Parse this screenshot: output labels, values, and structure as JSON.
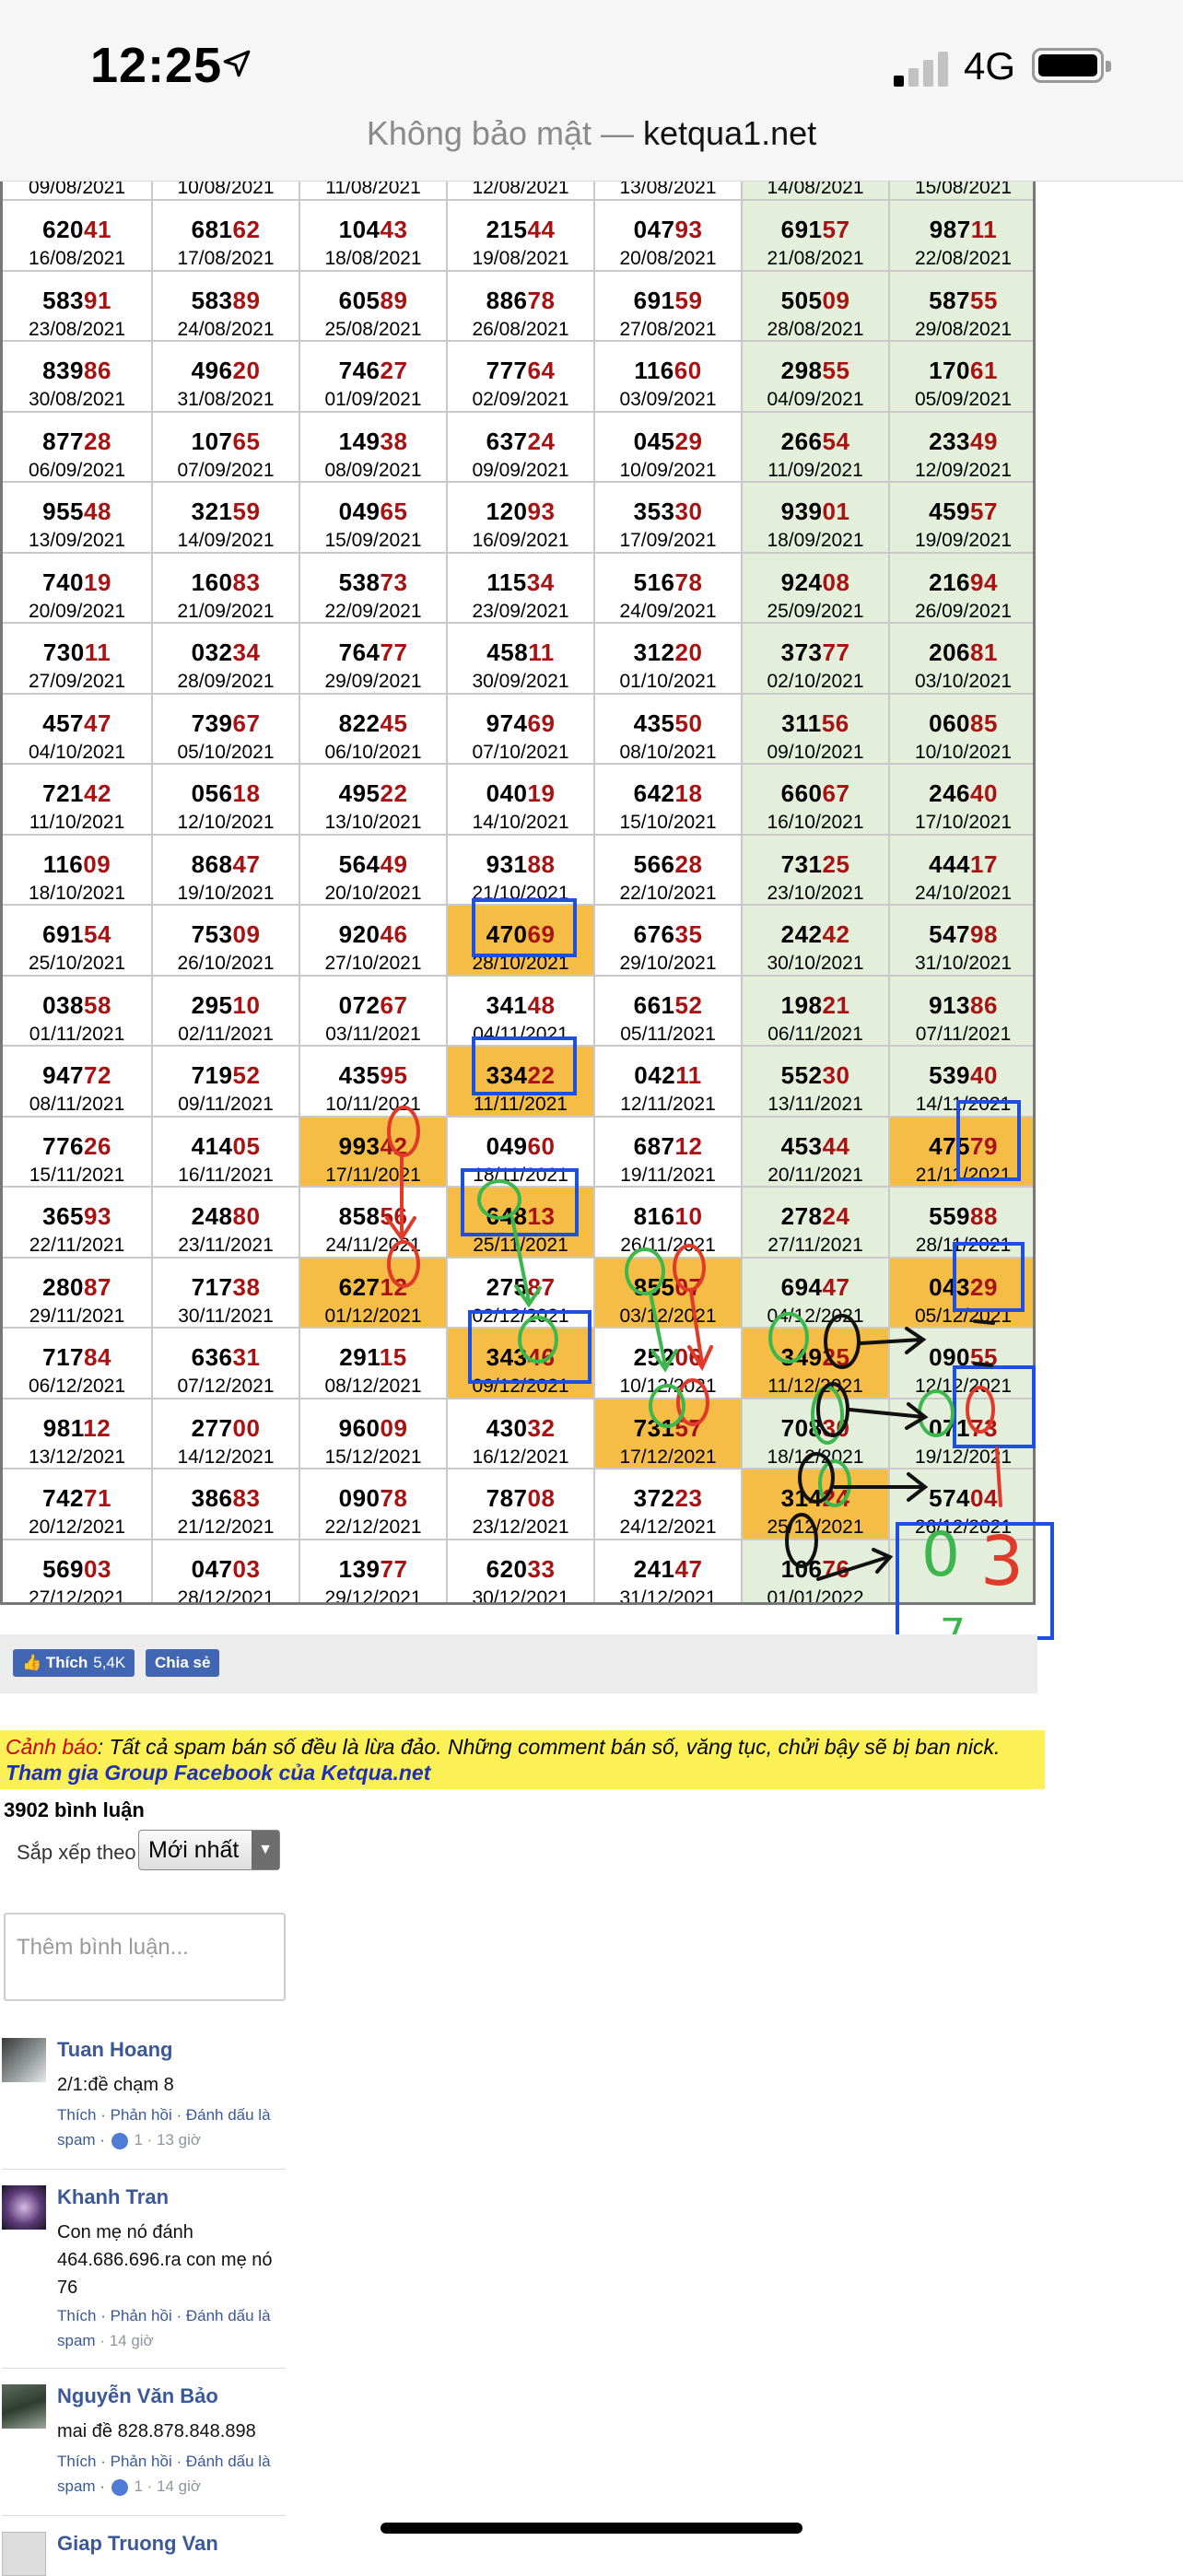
{
  "status": {
    "time": "12:25",
    "network": "4G"
  },
  "urlbar": {
    "insecure": "Không bảo mật — ",
    "domain": "ketqua1.net"
  },
  "table": {
    "rows": [
      [
        [
          "6",
          "2041",
          "16/08/2021"
        ],
        [
          "6",
          "8162",
          "17/08/2021"
        ],
        [
          "1",
          "0443",
          "18/08/2021"
        ],
        [
          "2",
          "1544",
          "19/08/2021"
        ],
        [
          "0",
          "4793",
          "20/08/2021"
        ],
        [
          "6",
          "9157",
          "21/08/2021"
        ],
        [
          "9",
          "8711",
          "22/08/2021"
        ]
      ],
      [
        [
          "5",
          "8391",
          "23/08/2021"
        ],
        [
          "5",
          "8389",
          "24/08/2021"
        ],
        [
          "6",
          "0589",
          "25/08/2021"
        ],
        [
          "8",
          "8678",
          "26/08/2021"
        ],
        [
          "6",
          "9159",
          "27/08/2021"
        ],
        [
          "5",
          "0509",
          "28/08/2021"
        ],
        [
          "5",
          "8755",
          "29/08/2021"
        ]
      ],
      [
        [
          "8",
          "3986",
          "30/08/2021"
        ],
        [
          "4",
          "9620",
          "31/08/2021"
        ],
        [
          "7",
          "4627",
          "01/09/2021"
        ],
        [
          "7",
          "7764",
          "02/09/2021"
        ],
        [
          "1",
          "1660",
          "03/09/2021"
        ],
        [
          "2",
          "9855",
          "04/09/2021"
        ],
        [
          "1",
          "7061",
          "05/09/2021"
        ]
      ],
      [
        [
          "8",
          "7728",
          "06/09/2021"
        ],
        [
          "1",
          "0765",
          "07/09/2021"
        ],
        [
          "1",
          "4938",
          "08/09/2021"
        ],
        [
          "6",
          "3724",
          "09/09/2021"
        ],
        [
          "0",
          "4529",
          "10/09/2021"
        ],
        [
          "2",
          "6654",
          "11/09/2021"
        ],
        [
          "2",
          "3349",
          "12/09/2021"
        ]
      ],
      [
        [
          "9",
          "5548",
          "13/09/2021"
        ],
        [
          "3",
          "2159",
          "14/09/2021"
        ],
        [
          "0",
          "4965",
          "15/09/2021"
        ],
        [
          "1",
          "2093",
          "16/09/2021"
        ],
        [
          "3",
          "5330",
          "17/09/2021"
        ],
        [
          "9",
          "3901",
          "18/09/2021"
        ],
        [
          "4",
          "5957",
          "19/09/2021"
        ]
      ],
      [
        [
          "7",
          "4019",
          "20/09/2021"
        ],
        [
          "1",
          "6083",
          "21/09/2021"
        ],
        [
          "5",
          "3873",
          "22/09/2021"
        ],
        [
          "1",
          "1534",
          "23/09/2021"
        ],
        [
          "5",
          "1678",
          "24/09/2021"
        ],
        [
          "9",
          "2408",
          "25/09/2021"
        ],
        [
          "2",
          "1694",
          "26/09/2021"
        ]
      ],
      [
        [
          "7",
          "3011",
          "27/09/2021"
        ],
        [
          "0",
          "3234",
          "28/09/2021"
        ],
        [
          "7",
          "6477",
          "29/09/2021"
        ],
        [
          "4",
          "5811",
          "30/09/2021"
        ],
        [
          "3",
          "1220",
          "01/10/2021"
        ],
        [
          "3",
          "7377",
          "02/10/2021"
        ],
        [
          "2",
          "0681",
          "03/10/2021"
        ]
      ],
      [
        [
          "4",
          "5747",
          "04/10/2021"
        ],
        [
          "7",
          "3967",
          "05/10/2021"
        ],
        [
          "8",
          "2245",
          "06/10/2021"
        ],
        [
          "9",
          "7469",
          "07/10/2021"
        ],
        [
          "4",
          "3550",
          "08/10/2021"
        ],
        [
          "3",
          "1156",
          "09/10/2021"
        ],
        [
          "0",
          "6085",
          "10/10/2021"
        ]
      ],
      [
        [
          "7",
          "2142",
          "11/10/2021"
        ],
        [
          "0",
          "5618",
          "12/10/2021"
        ],
        [
          "4",
          "9522",
          "13/10/2021"
        ],
        [
          "0",
          "4019",
          "14/10/2021"
        ],
        [
          "6",
          "4218",
          "15/10/2021"
        ],
        [
          "6",
          "6067",
          "16/10/2021"
        ],
        [
          "2",
          "4640",
          "17/10/2021"
        ]
      ],
      [
        [
          "1",
          "1609",
          "18/10/2021"
        ],
        [
          "8",
          "6847",
          "19/10/2021"
        ],
        [
          "5",
          "6449",
          "20/10/2021"
        ],
        [
          "9",
          "3188",
          "21/10/2021"
        ],
        [
          "5",
          "6628",
          "22/10/2021"
        ],
        [
          "7",
          "3125",
          "23/10/2021"
        ],
        [
          "4",
          "4417",
          "24/10/2021"
        ]
      ],
      [
        [
          "6",
          "9154",
          "25/10/2021"
        ],
        [
          "7",
          "5309",
          "26/10/2021"
        ],
        [
          "9",
          "2046",
          "27/10/2021"
        ],
        [
          "4",
          "7069",
          "28/10/2021"
        ],
        [
          "6",
          "7635",
          "29/10/2021"
        ],
        [
          "2",
          "4242",
          "30/10/2021"
        ],
        [
          "5",
          "4798",
          "31/10/2021"
        ]
      ],
      [
        [
          "0",
          "3858",
          "01/11/2021"
        ],
        [
          "2",
          "9510",
          "02/11/2021"
        ],
        [
          "0",
          "7267",
          "03/11/2021"
        ],
        [
          "3",
          "4148",
          "04/11/2021"
        ],
        [
          "6",
          "6152",
          "05/11/2021"
        ],
        [
          "1",
          "9821",
          "06/11/2021"
        ],
        [
          "9",
          "1386",
          "07/11/2021"
        ]
      ],
      [
        [
          "9",
          "4772",
          "08/11/2021"
        ],
        [
          "7",
          "1952",
          "09/11/2021"
        ],
        [
          "4",
          "3595",
          "10/11/2021"
        ],
        [
          "3",
          "3422",
          "11/11/2021"
        ],
        [
          "0",
          "4211",
          "12/11/2021"
        ],
        [
          "5",
          "5230",
          "13/11/2021"
        ],
        [
          "5",
          "3940",
          "14/11/2021"
        ]
      ],
      [
        [
          "7",
          "7626",
          "15/11/2021"
        ],
        [
          "4",
          "1405",
          "16/11/2021"
        ],
        [
          "9",
          "9342",
          "17/11/2021"
        ],
        [
          "0",
          "4960",
          "18/11/2021"
        ],
        [
          "6",
          "8712",
          "19/11/2021"
        ],
        [
          "4",
          "5344",
          "20/11/2021"
        ],
        [
          "4",
          "7579",
          "21/11/2021"
        ]
      ],
      [
        [
          "3",
          "6593",
          "22/11/2021"
        ],
        [
          "2",
          "4880",
          "23/11/2021"
        ],
        [
          "8",
          "5856",
          "24/11/2021"
        ],
        [
          "6",
          "4813",
          "25/11/2021"
        ],
        [
          "8",
          "1610",
          "26/11/2021"
        ],
        [
          "2",
          "7824",
          "27/11/2021"
        ],
        [
          "5",
          "5988",
          "28/11/2021"
        ]
      ],
      [
        [
          "2",
          "8087",
          "29/11/2021"
        ],
        [
          "7",
          "1738",
          "30/11/2021"
        ],
        [
          "6",
          "2712",
          "01/12/2021"
        ],
        [
          "2",
          "7587",
          "02/12/2021"
        ],
        [
          "8",
          "5507",
          "03/12/2021"
        ],
        [
          "6",
          "9447",
          "04/12/2021"
        ],
        [
          "0",
          "4329",
          "05/12/2021"
        ]
      ],
      [
        [
          "7",
          "1784",
          "06/12/2021"
        ],
        [
          "6",
          "3631",
          "07/12/2021"
        ],
        [
          "2",
          "9115",
          "08/12/2021"
        ],
        [
          "3",
          "4346",
          "09/12/2021"
        ],
        [
          "2",
          "5206",
          "10/12/2021"
        ],
        [
          "3",
          "4925",
          "11/12/2021"
        ],
        [
          "0",
          "9055",
          "12/12/2021"
        ]
      ],
      [
        [
          "9",
          "8112",
          "13/12/2021"
        ],
        [
          "2",
          "7700",
          "14/12/2021"
        ],
        [
          "9",
          "6009",
          "15/12/2021"
        ],
        [
          "4",
          "3032",
          "16/12/2021"
        ],
        [
          "7",
          "3157",
          "17/12/2021"
        ],
        [
          "7",
          "0830",
          "18/12/2021"
        ],
        [
          "0",
          "7173",
          "19/12/2021"
        ]
      ],
      [
        [
          "7",
          "4271",
          "20/12/2021"
        ],
        [
          "3",
          "8683",
          "21/12/2021"
        ],
        [
          "0",
          "9078",
          "22/12/2021"
        ],
        [
          "7",
          "8708",
          "23/12/2021"
        ],
        [
          "3",
          "7223",
          "24/12/2021"
        ],
        [
          "3",
          "1424",
          "25/12/2021"
        ],
        [
          "5",
          "7404",
          "26/12/2021"
        ]
      ],
      [
        [
          "5",
          "6903",
          "27/12/2021"
        ],
        [
          "0",
          "4703",
          "28/12/2021"
        ],
        [
          "1",
          "3977",
          "29/12/2021"
        ],
        [
          "6",
          "2033",
          "30/12/2021"
        ],
        [
          "2",
          "4147",
          "31/12/2021"
        ],
        [
          "1",
          "0676",
          "01/01/2022"
        ],
        [
          "",
          "",
          ""
        ]
      ]
    ],
    "partial_dates": [
      "09/08/2021",
      "10/08/2021",
      "11/08/2021",
      "12/08/2021",
      "13/08/2021",
      "14/08/2021",
      "15/08/2021"
    ],
    "highlighted_cells": [
      [
        10,
        3
      ],
      [
        12,
        3
      ],
      [
        13,
        2
      ],
      [
        13,
        6
      ],
      [
        14,
        3
      ],
      [
        15,
        2
      ],
      [
        15,
        4
      ],
      [
        15,
        6
      ],
      [
        16,
        3
      ],
      [
        16,
        5
      ],
      [
        17,
        4
      ],
      [
        18,
        5
      ]
    ]
  },
  "social": {
    "like_label": "Thích",
    "like_count": "5,4K",
    "share_label": "Chia sẻ"
  },
  "warning": {
    "prefix": "Cảnh báo",
    "text": ": Tất cả spam bán số đều là lừa đảo. Những comment bán số, văng tục, chửi bậy sẽ bị ban nick.",
    "link": "Tham gia Group Facebook của Ketqua.net"
  },
  "comments_section": {
    "count": "3902 bình luận",
    "sort_label": "Sắp xếp theo",
    "sort_value": "Mới nhất",
    "input_placeholder": "Thêm bình luận..."
  },
  "comments": [
    {
      "name": "Tuan Hoang",
      "text": "2/1:đề chạm 8",
      "actions": "Thích · Phản hồi · Đánh dấu là spam ·",
      "likes": "1",
      "time": "· 13 giờ"
    },
    {
      "name": "Khanh Tran",
      "text": "Con mẹ nó đánh 464.686.696.ra con mẹ nó 76",
      "actions": "Thích · Phản hồi · Đánh dấu là spam",
      "likes": "",
      "time": "· 14 giờ"
    },
    {
      "name": "Nguyễn Văn Bảo",
      "text": "mai đề 828.878.848.898",
      "actions": "Thích · Phản hồi · Đánh dấu là spam ·",
      "likes": "1",
      "time": "· 14 giờ"
    },
    {
      "name": "Giap Truong Van",
      "text": "",
      "actions": "",
      "likes": "",
      "time": ""
    }
  ],
  "annotation_text": {
    "green_digit": "0",
    "red_digit": "3",
    "green_note": "7"
  },
  "colors": {
    "weekend": "#e3efdb",
    "highlight": "#f5bd45",
    "tail_digits": "#a81212",
    "fb_blue": "#4267b2",
    "warning_bg": "#fbf157"
  }
}
